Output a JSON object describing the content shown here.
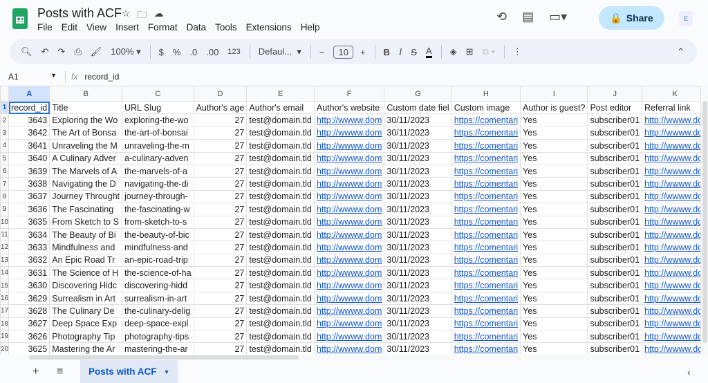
{
  "doc": {
    "title": "Posts with ACF"
  },
  "menu": [
    "File",
    "Edit",
    "View",
    "Insert",
    "Format",
    "Data",
    "Tools",
    "Extensions",
    "Help"
  ],
  "share_label": "Share",
  "avatar": "E",
  "toolbar": {
    "zoom": "100%",
    "currency": "$",
    "percent": "%",
    "dec_dec": ".0",
    "inc_dec": ".00",
    "number_format": "123",
    "font": "Defaul...",
    "font_size": "10",
    "bold": "B",
    "italic": "I",
    "strike": "S",
    "text_color": "A"
  },
  "formula_bar": {
    "cell_ref": "A1",
    "fx": "fx",
    "value": "record_id"
  },
  "columns": [
    "A",
    "B",
    "C",
    "D",
    "E",
    "F",
    "G",
    "H",
    "I",
    "J",
    "K"
  ],
  "headers": [
    "record_id",
    "Title",
    "URL Slug",
    "Author's age",
    "Author's email",
    "Author's website",
    "Custom date fiel",
    "Custom image",
    "Author is guest?",
    "Post editor",
    "Referral link"
  ],
  "rows": [
    [
      "3643",
      "Exploring the Wo",
      "exploring-the-wo"
    ],
    [
      "3642",
      "The Art of Bonsa",
      "the-art-of-bonsai"
    ],
    [
      "3641",
      "Unraveling the M",
      "unraveling-the-m"
    ],
    [
      "3640",
      "A Culinary Adver",
      "a-culinary-adven"
    ],
    [
      "3639",
      "The Marvels of A",
      "the-marvels-of-a"
    ],
    [
      "3638",
      "Navigating the D",
      "navigating-the-di"
    ],
    [
      "3637",
      "Journey Throught",
      "journey-through-"
    ],
    [
      "3636",
      "The Fascinating",
      "the-fascinating-w"
    ],
    [
      "3635",
      "From Sketch to S",
      "from-sketch-to-s"
    ],
    [
      "3634",
      "The Beauty of Bi",
      "the-beauty-of-bic"
    ],
    [
      "3633",
      "Mindfulness and",
      "mindfulness-and"
    ],
    [
      "3632",
      "An Epic Road Tr",
      "an-epic-road-trip"
    ],
    [
      "3631",
      "The Science of H",
      "the-science-of-ha"
    ],
    [
      "3630",
      "Discovering Hidc",
      "discovering-hidd"
    ],
    [
      "3629",
      "Surrealism in Art",
      "surrealism-in-art"
    ],
    [
      "3628",
      "The Culinary De",
      "the-culinary-delig"
    ],
    [
      "3627",
      "Deep Space Exp",
      "deep-space-expl"
    ],
    [
      "3626",
      "Photography Tip",
      "photography-tips"
    ],
    [
      "3625",
      "Mastering the Ar",
      "mastering-the-ar"
    ]
  ],
  "common": {
    "age": "27",
    "email": "test@domain.tld",
    "website": "http://wwww.dom",
    "date": "30/11/2023",
    "image": "https://comentari",
    "guest": "Yes",
    "editor": "subscriber01",
    "referral": "http://wwww.dor"
  },
  "sheet_tab": "Posts with ACF"
}
